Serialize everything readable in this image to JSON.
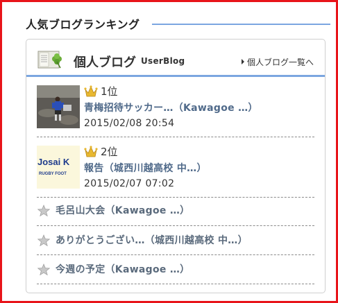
{
  "section": {
    "title": "人気ブログランキング"
  },
  "card": {
    "title": "個人ブログ",
    "subtitle": "UserBlog",
    "link_label": "個人ブログ一覧へ"
  },
  "top_ranked": [
    {
      "rank": "1位",
      "title": "青梅招待サッカー…（Kawagoe …）",
      "date": "2015/02/08 20:54",
      "thumb": "soccer-player-photo"
    },
    {
      "rank": "2位",
      "title": "報告（城西川越高校 中…）",
      "date": "2015/02/07 07:02",
      "thumb": "josai-rugby-logo",
      "thumb_text": "Josai K",
      "thumb_subtext": "RUGBY FOOT"
    }
  ],
  "other_ranked": [
    {
      "title": "毛呂山大会（Kawagoe …）"
    },
    {
      "title": "ありがとうござい…（城西川越高校 中…）"
    },
    {
      "title": "今週の予定（Kawagoe …）"
    }
  ],
  "colors": {
    "frame": "#e8141a",
    "accent_line": "#7ba6e0",
    "link_top": "#506a8a",
    "link_other": "#5a6a7c",
    "crown": "#e8b830"
  }
}
